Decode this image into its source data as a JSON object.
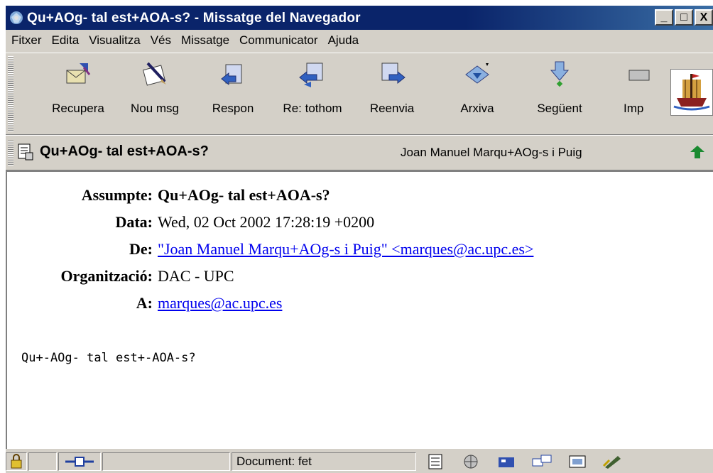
{
  "window": {
    "title": "Qu+AOg- tal est+AOA-s? - Missatge del Navegador",
    "minimize": "_",
    "maximize": "□",
    "close": "X"
  },
  "menu": [
    {
      "label": "Fitxer"
    },
    {
      "label": "Edita"
    },
    {
      "label": "Visualitza"
    },
    {
      "label": "Vés"
    },
    {
      "label": "Missatge"
    },
    {
      "label": "Communicator"
    },
    {
      "label": "Ajuda"
    }
  ],
  "toolbar": {
    "buttons": [
      {
        "label": "Recupera",
        "icon": "get-mail-icon"
      },
      {
        "label": "Nou msg",
        "icon": "new-message-icon"
      },
      {
        "label": "Respon",
        "icon": "reply-icon"
      },
      {
        "label": "Re: tothom",
        "icon": "reply-all-icon"
      },
      {
        "label": "Reenvia",
        "icon": "forward-icon"
      },
      {
        "label": "Arxiva",
        "icon": "file-icon"
      },
      {
        "label": "Següent",
        "icon": "next-icon"
      },
      {
        "label": "Imp",
        "icon": "print-icon"
      }
    ],
    "logo": "ship-logo-icon"
  },
  "header": {
    "subject": "Qu+AOg- tal est+AOA-s?",
    "sender": "Joan Manuel Marqu+AOg-s i Puig"
  },
  "message": {
    "fields": [
      {
        "label": "Assumpte:",
        "value": "Qu+AOg- tal est+AOA-s?",
        "bold": true,
        "link": false
      },
      {
        "label": "Data:",
        "value": "Wed, 02 Oct 2002 17:28:19 +0200",
        "bold": false,
        "link": false
      },
      {
        "label": "De:",
        "value": "\"Joan Manuel Marqu+AOg-s i Puig\" <marques@ac.upc.es>",
        "bold": false,
        "link": true
      },
      {
        "label": "Organització:",
        "value": "DAC - UPC",
        "bold": false,
        "link": false
      },
      {
        "label": "A:",
        "value": "marques@ac.upc.es",
        "bold": false,
        "link": true
      }
    ],
    "body": "Qu+-AOg- tal est+-AOA-s?"
  },
  "status": {
    "text": "Document: fet"
  },
  "colors": {
    "titlebar": "#0a246a",
    "chrome": "#d4d0c8",
    "link": "#0000ee"
  }
}
